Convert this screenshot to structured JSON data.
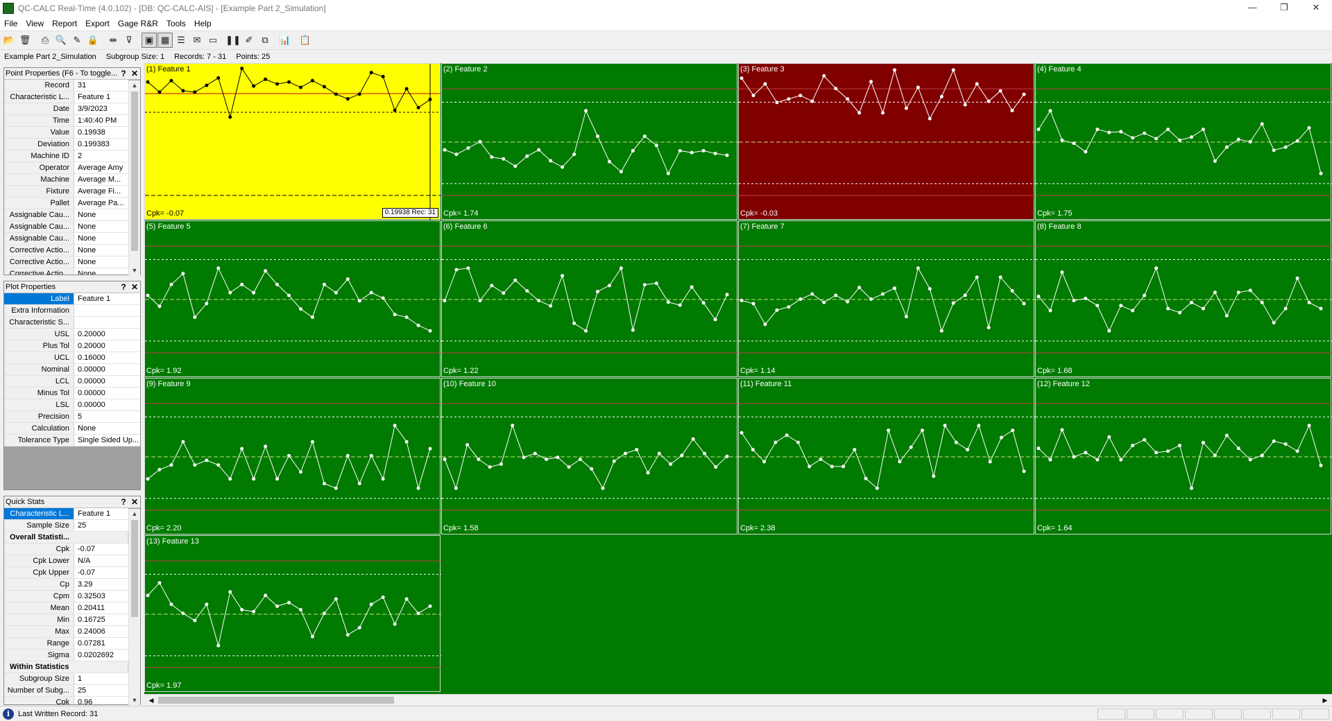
{
  "window": {
    "title": "QC-CALC Real-Time (4.0.102) - [DB: QC-CALC-AIS] - [Example Part 2_Simulation]"
  },
  "menu": [
    "File",
    "View",
    "Report",
    "Export",
    "Gage R&R",
    "Tools",
    "Help"
  ],
  "toolbar": [
    {
      "icon": "open-folder-icon",
      "glyph": "📂"
    },
    {
      "icon": "delete-icon",
      "glyph": "🗑"
    },
    {
      "sep": true
    },
    {
      "icon": "print-icon",
      "glyph": "⎙"
    },
    {
      "icon": "print-preview-icon",
      "glyph": "🔍"
    },
    {
      "icon": "edit-chart-icon",
      "glyph": "✎"
    },
    {
      "icon": "lock-icon",
      "glyph": "🔒"
    },
    {
      "sep": true
    },
    {
      "icon": "range-icon",
      "glyph": "⇹"
    },
    {
      "icon": "filter-icon",
      "glyph": "⊽"
    },
    {
      "sep": true
    },
    {
      "icon": "single-chart-icon",
      "glyph": "▣",
      "active": true
    },
    {
      "icon": "multi-chart-icon",
      "glyph": "▦",
      "active": true
    },
    {
      "icon": "list-view-icon",
      "glyph": "☰"
    },
    {
      "icon": "note-icon",
      "glyph": "✉"
    },
    {
      "icon": "display-icon",
      "glyph": "▭"
    },
    {
      "sep": true
    },
    {
      "icon": "pause-icon",
      "glyph": "❚❚"
    },
    {
      "icon": "pencil-icon",
      "glyph": "✐"
    },
    {
      "icon": "copy-window-icon",
      "glyph": "⧉"
    },
    {
      "sep": true
    },
    {
      "icon": "histogram-icon",
      "glyph": "📊"
    },
    {
      "sep": true
    },
    {
      "icon": "clipboard-icon",
      "glyph": "📋"
    }
  ],
  "infobar": {
    "part": "Example Part 2_Simulation",
    "subgroup": "Subgroup Size: 1",
    "records": "Records: 7 - 31",
    "points": "Points: 25"
  },
  "point_props": {
    "title": "Point Properties (F6 - To toggle...",
    "rows": [
      {
        "k": "Record",
        "v": "31"
      },
      {
        "k": "Characteristic L...",
        "v": "Feature 1"
      },
      {
        "k": "Date",
        "v": "3/9/2023"
      },
      {
        "k": "Time",
        "v": "1:40:40 PM"
      },
      {
        "k": "Value",
        "v": "0.19938"
      },
      {
        "k": "Deviation",
        "v": "0.199383"
      },
      {
        "k": "Machine ID",
        "v": "2"
      },
      {
        "k": "Operator",
        "v": "Average Amy"
      },
      {
        "k": "Machine",
        "v": "Average M..."
      },
      {
        "k": "Fixture",
        "v": "Average Fi..."
      },
      {
        "k": "Pallet",
        "v": "Average Pa..."
      },
      {
        "k": "Assignable Cau...",
        "v": "None"
      },
      {
        "k": "Assignable Cau...",
        "v": "None"
      },
      {
        "k": "Assignable Cau...",
        "v": "None"
      },
      {
        "k": "Corrective Actio...",
        "v": "None"
      },
      {
        "k": "Corrective Actio...",
        "v": "None"
      },
      {
        "k": "Corrective Actio...",
        "v": "None"
      }
    ]
  },
  "plot_props": {
    "title": "Plot Properties",
    "rows": [
      {
        "k": "Label",
        "v": "Feature 1",
        "sel": true
      },
      {
        "k": "Extra Information",
        "v": ""
      },
      {
        "k": "Characteristic S...",
        "v": ""
      },
      {
        "k": "USL",
        "v": "0.20000"
      },
      {
        "k": "Plus Tol",
        "v": "0.20000"
      },
      {
        "k": "UCL",
        "v": "0.16000"
      },
      {
        "k": "Nominal",
        "v": "0.00000"
      },
      {
        "k": "LCL",
        "v": "0.00000"
      },
      {
        "k": "Minus Tol",
        "v": "0.00000"
      },
      {
        "k": "LSL",
        "v": "0.00000"
      },
      {
        "k": "Precision",
        "v": "5"
      },
      {
        "k": "Calculation",
        "v": "None"
      },
      {
        "k": "Tolerance Type",
        "v": "Single Sided Up..."
      }
    ]
  },
  "quick_stats": {
    "title": "Quick Stats",
    "rows": [
      {
        "k": "Characteristic L...",
        "v": "Feature 1",
        "sel": true
      },
      {
        "k": "Sample Size",
        "v": "25"
      },
      {
        "k": "Overall Statisti...",
        "section": true
      },
      {
        "k": "Cpk",
        "v": "-0.07"
      },
      {
        "k": "Cpk Lower",
        "v": "N/A"
      },
      {
        "k": "Cpk Upper",
        "v": "-0.07"
      },
      {
        "k": "Cp",
        "v": "3.29"
      },
      {
        "k": "Cpm",
        "v": "0.32503"
      },
      {
        "k": "Mean",
        "v": "0.20411"
      },
      {
        "k": "Min",
        "v": "0.16725"
      },
      {
        "k": "Max",
        "v": "0.24006"
      },
      {
        "k": "Range",
        "v": "0.07281"
      },
      {
        "k": "Sigma",
        "v": "0.0202692"
      },
      {
        "k": "Within Statistics",
        "section": true
      },
      {
        "k": "Subgroup Size",
        "v": "1"
      },
      {
        "k": "Number of Subg...",
        "v": "25"
      },
      {
        "k": "Cpk",
        "v": "0.96"
      }
    ]
  },
  "colors": {
    "ok": "#007a00",
    "warn": "#ffff00",
    "bad": "#800000"
  },
  "charts": [
    {
      "name": "(1) Feature 1",
      "cpk": "Cpk= -0.07",
      "status": "warn",
      "readout": "0.19938 Rec: 31",
      "values": [
        0.22,
        0.205,
        0.222,
        0.207,
        0.205,
        0.215,
        0.226,
        0.168,
        0.24,
        0.214,
        0.224,
        0.217,
        0.22,
        0.212,
        0.222,
        0.213,
        0.202,
        0.195,
        0.202,
        0.234,
        0.228,
        0.178,
        0.21,
        0.182,
        0.194
      ]
    },
    {
      "name": "(2) Feature 2",
      "cpk": "Cpk= 1.74",
      "status": "ok",
      "values": [
        0.3,
        -0.2,
        0.5,
        1.2,
        -0.5,
        -0.7,
        -1.5,
        -0.4,
        0.3,
        -0.9,
        -1.6,
        -0.2,
        4.6,
        1.8,
        -1.0,
        -2.1,
        0.2,
        1.8,
        0.8,
        -2.3,
        0.2,
        0.0,
        0.2,
        -0.1,
        -0.3
      ]
    },
    {
      "name": "(3) Feature 3",
      "cpk": "Cpk= -0.03",
      "status": "bad",
      "values": [
        0.48,
        0.33,
        0.43,
        0.27,
        0.3,
        0.33,
        0.28,
        0.5,
        0.39,
        0.3,
        0.18,
        0.45,
        0.18,
        0.55,
        0.22,
        0.4,
        0.13,
        0.32,
        0.55,
        0.25,
        0.43,
        0.28,
        0.37,
        0.2,
        0.34
      ]
    },
    {
      "name": "(4) Feature 4",
      "cpk": "Cpk= 1.75",
      "status": "ok",
      "values": [
        0.8,
        3.2,
        -0.6,
        -1.0,
        -2.1,
        0.8,
        0.4,
        0.5,
        -0.3,
        0.3,
        -0.4,
        0.8,
        -0.6,
        -0.2,
        0.8,
        -3.3,
        -1.5,
        -0.5,
        -0.8,
        1.5,
        -1.9,
        -1.5,
        -0.7,
        1.0,
        -4.9
      ]
    },
    {
      "name": "(5) Feature 5",
      "cpk": "Cpk= 1.92",
      "status": "ok",
      "values": [
        0.0,
        -0.8,
        0.8,
        1.6,
        -1.6,
        -0.6,
        2.0,
        0.2,
        0.8,
        0.2,
        1.8,
        0.8,
        0.0,
        -1.0,
        -1.6,
        0.8,
        0.2,
        1.2,
        -0.4,
        0.2,
        -0.2,
        -1.4,
        -1.6,
        -2.2,
        -2.6
      ]
    },
    {
      "name": "(6) Feature 6",
      "cpk": "Cpk= 1.22",
      "status": "ok",
      "values": [
        -0.5,
        3.6,
        3.8,
        -0.5,
        1.5,
        0.5,
        2.2,
        0.8,
        -0.5,
        -1.2,
        2.8,
        -3.5,
        -4.5,
        0.7,
        1.5,
        3.8,
        -4.4,
        1.6,
        1.8,
        -0.7,
        -1.1,
        1.3,
        -0.8,
        -3.0,
        0.3
      ]
    },
    {
      "name": "(7) Feature 7",
      "cpk": "Cpk= 1.14",
      "status": "ok",
      "values": [
        0.0,
        -0.5,
        -3.7,
        -1.5,
        -1.0,
        0.2,
        1.0,
        -0.3,
        0.8,
        -0.2,
        2.0,
        0.2,
        1.0,
        1.9,
        -2.5,
        5.0,
        1.8,
        -4.7,
        -0.4,
        0.8,
        3.6,
        -4.2,
        3.6,
        1.5,
        -0.5
      ]
    },
    {
      "name": "(8) Feature 8",
      "cpk": "Cpk= 1.68",
      "status": "ok",
      "values": [
        0.4,
        -1.0,
        2.8,
        0.0,
        0.2,
        -0.5,
        -3.0,
        -0.5,
        -1.0,
        0.5,
        3.2,
        -0.8,
        -1.2,
        -0.2,
        -0.8,
        0.8,
        -1.5,
        0.8,
        1.0,
        -0.2,
        -2.2,
        -0.8,
        2.2,
        -0.2,
        -0.8
      ]
    },
    {
      "name": "(9) Feature 9",
      "cpk": "Cpk= 2.20",
      "status": "ok",
      "values": [
        -0.8,
        -0.4,
        -0.2,
        0.8,
        -0.2,
        0.0,
        -0.2,
        -0.8,
        0.5,
        -0.8,
        0.6,
        -0.8,
        0.2,
        -0.5,
        0.8,
        -1.0,
        -1.2,
        0.2,
        -1.0,
        0.2,
        -0.8,
        1.5,
        0.8,
        -1.2,
        0.5
      ]
    },
    {
      "name": "(10) Feature 10",
      "cpk": "Cpk= 1.58",
      "status": "ok",
      "values": [
        0.0,
        -3.0,
        1.5,
        0.0,
        -0.8,
        -0.5,
        3.5,
        0.2,
        0.6,
        0.0,
        0.2,
        -0.8,
        0.0,
        -1.0,
        -3.0,
        -0.2,
        0.6,
        1.0,
        -1.4,
        0.6,
        -0.5,
        0.4,
        2.1,
        0.6,
        -0.8,
        0.3
      ]
    },
    {
      "name": "(11) Feature 11",
      "cpk": "Cpk= 2.38",
      "status": "ok",
      "values": [
        1.0,
        0.3,
        -0.2,
        0.6,
        0.9,
        0.6,
        -0.4,
        -0.1,
        -0.4,
        -0.4,
        0.3,
        -0.9,
        -1.3,
        1.1,
        -0.2,
        0.4,
        1.1,
        -0.8,
        1.3,
        0.6,
        0.3,
        1.3,
        -0.2,
        0.8,
        1.1,
        -0.6
      ]
    },
    {
      "name": "(12) Feature 12",
      "cpk": "Cpk= 1.64",
      "status": "ok",
      "values": [
        0.0,
        -0.8,
        1.3,
        -0.6,
        -0.3,
        -0.8,
        0.8,
        -0.8,
        0.2,
        0.6,
        -0.3,
        -0.2,
        0.2,
        -2.8,
        0.4,
        -0.5,
        0.9,
        0.0,
        -0.8,
        -0.5,
        0.5,
        0.3,
        -0.2,
        1.6,
        -1.2
      ]
    },
    {
      "name": "(13) Feature 13",
      "cpk": "Cpk= 1.97",
      "status": "ok",
      "values": [
        0.8,
        1.5,
        0.3,
        -0.2,
        -0.6,
        0.3,
        -2.0,
        1.0,
        0.0,
        -0.1,
        0.8,
        0.2,
        0.4,
        0.0,
        -1.5,
        -0.2,
        0.6,
        -1.4,
        -1.0,
        0.3,
        0.7,
        -0.8,
        0.6,
        -0.2,
        0.2
      ]
    }
  ],
  "statusbar": {
    "text": "Last Written Record: 31"
  }
}
